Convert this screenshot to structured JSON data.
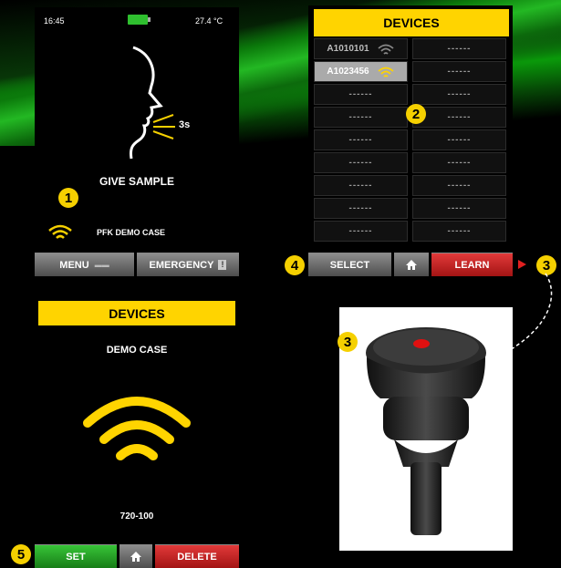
{
  "screen1": {
    "time": "16:45",
    "temperature": "27.4 °C",
    "timer": "3s",
    "instruction": "GIVE SAMPLE",
    "device_name": "PFK DEMO CASE",
    "menu_label": "MENU",
    "emergency_label": "EMERGENCY",
    "badge": "1"
  },
  "screen2": {
    "title": "DEVICES",
    "badge": "2",
    "rows": [
      {
        "left": "A1010101",
        "right": "------"
      },
      {
        "left": "A1023456",
        "right": "------"
      },
      {
        "left": "------",
        "right": "------"
      },
      {
        "left": "------",
        "right": "------"
      },
      {
        "left": "------",
        "right": "------"
      },
      {
        "left": "------",
        "right": "------"
      },
      {
        "left": "------",
        "right": "------"
      },
      {
        "left": "------",
        "right": "------"
      },
      {
        "left": "------",
        "right": "------"
      }
    ],
    "select_label": "SELECT",
    "learn_label": "LEARN",
    "select_badge": "4",
    "learn_badge": "3"
  },
  "screen3": {
    "title": "DEVICES",
    "subtitle": "DEMO CASE",
    "device_id": "720-100",
    "set_label": "SET",
    "delete_label": "DELETE",
    "badge": "5"
  },
  "photo": {
    "badge": "3"
  },
  "colors": {
    "yellow": "#ffd400",
    "red": "#c52222",
    "green": "#27a827"
  }
}
